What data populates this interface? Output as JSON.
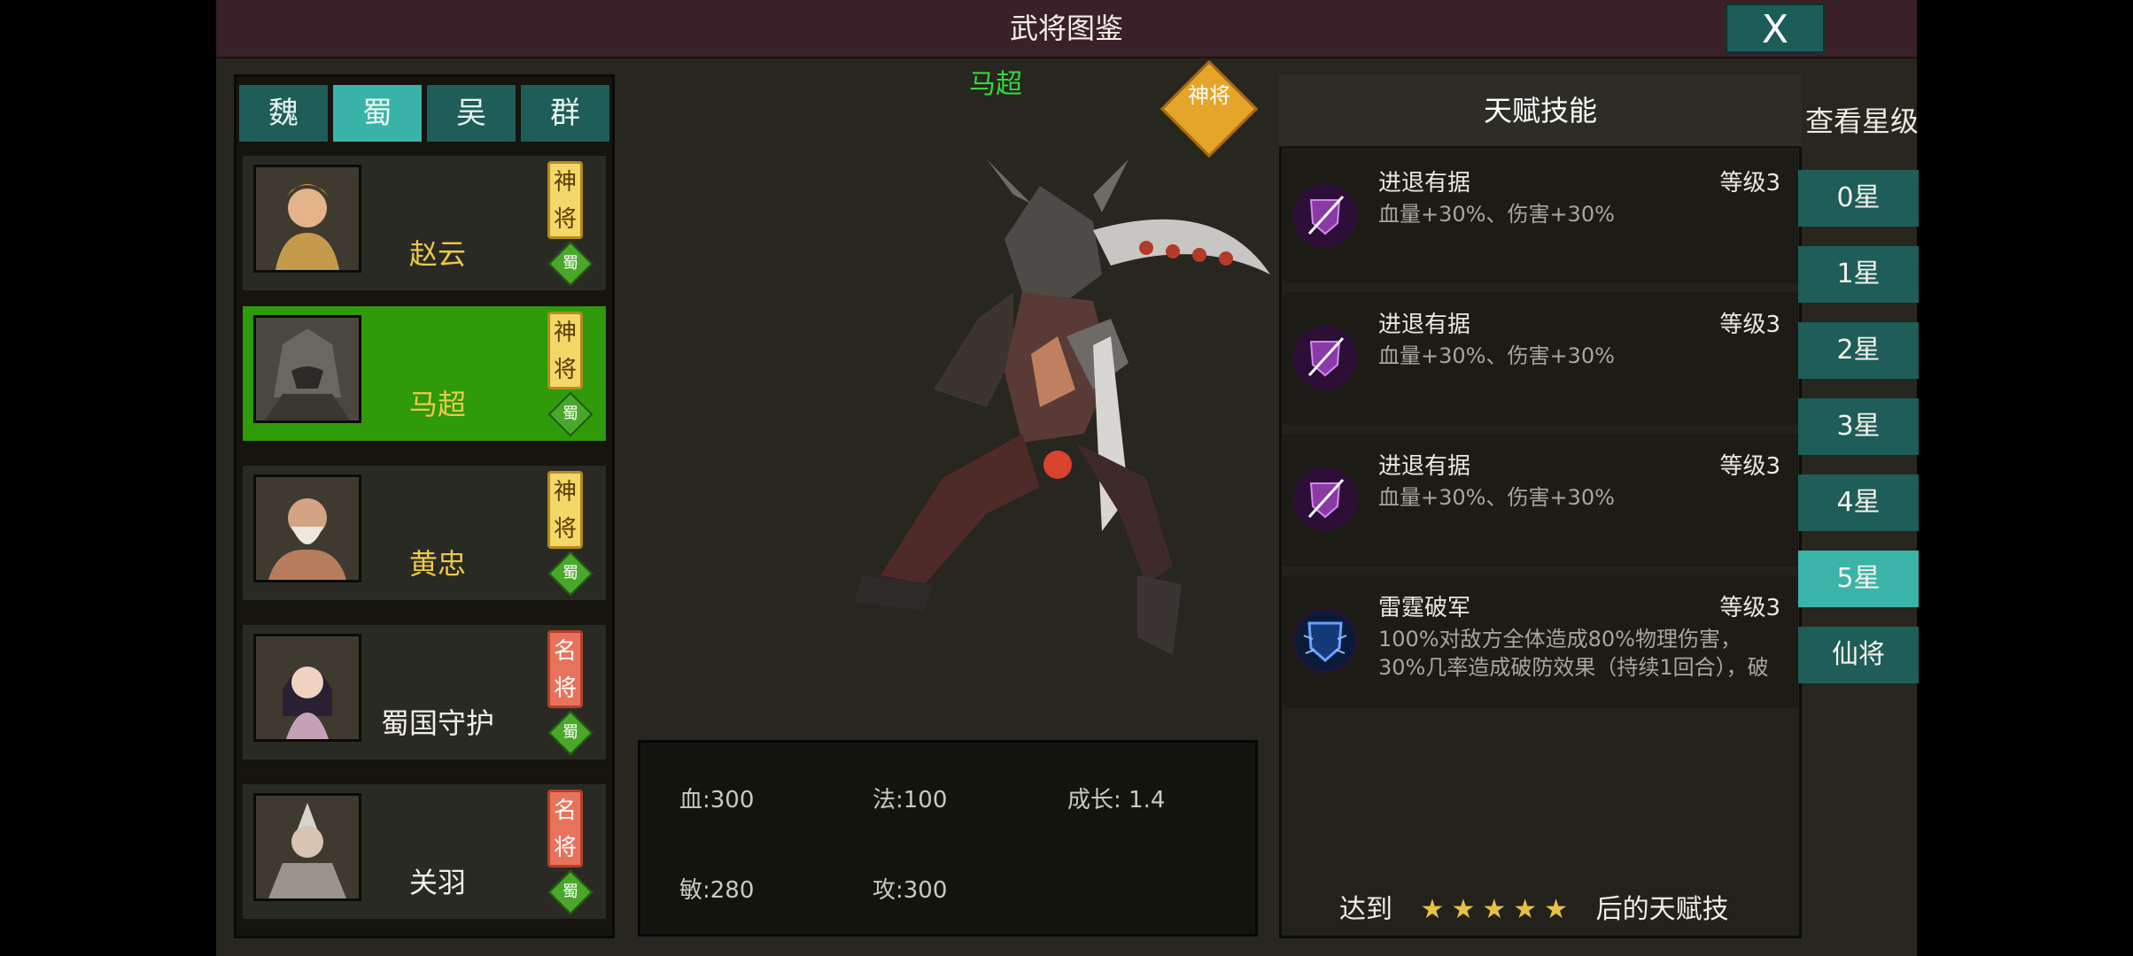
{
  "window": {
    "title": "武将图鉴",
    "close_label": "X"
  },
  "faction_tabs": [
    {
      "label": "魏",
      "active": false
    },
    {
      "label": "蜀",
      "active": true
    },
    {
      "label": "吴",
      "active": false
    },
    {
      "label": "群",
      "active": false
    }
  ],
  "heroes": [
    {
      "name": "赵云",
      "rank": "神将",
      "faction": "蜀",
      "selected": false
    },
    {
      "name": "马超",
      "rank": "神将",
      "faction": "蜀",
      "selected": true
    },
    {
      "name": "黄忠",
      "rank": "神将",
      "faction": "蜀",
      "selected": false
    },
    {
      "name": "蜀国守护",
      "rank": "名将",
      "faction": "蜀",
      "selected": false
    },
    {
      "name": "关羽",
      "rank": "名将",
      "faction": "蜀",
      "selected": false
    }
  ],
  "selected_hero": {
    "name": "马超",
    "rank_badge": "神将"
  },
  "stats": {
    "hp": "血:300",
    "mp": "法:100",
    "growth": "成长: 1.4",
    "agility": "敏:280",
    "attack": "攻:300"
  },
  "talent_panel": {
    "title": "天赋技能",
    "skills": [
      {
        "name": "进退有据",
        "level": "等级3",
        "desc": "血量+30%、伤害+30%",
        "icon": "purple-shield-sword-icon"
      },
      {
        "name": "进退有据",
        "level": "等级3",
        "desc": "血量+30%、伤害+30%",
        "icon": "purple-shield-sword-icon"
      },
      {
        "name": "进退有据",
        "level": "等级3",
        "desc": "血量+30%、伤害+30%",
        "icon": "purple-shield-sword-icon"
      },
      {
        "name": "雷霆破军",
        "level": "等级3",
        "desc": "100%对敌方全体造成80%物理伤害，30%几率造成破防效果（持续1回合），破",
        "icon": "blue-lightning-shield-icon"
      }
    ],
    "footer_prefix": "达到",
    "footer_stars": 5,
    "footer_suffix": "后的天赋技"
  },
  "star_selector": {
    "title": "查看星级",
    "options": [
      {
        "label": "0星",
        "active": false
      },
      {
        "label": "1星",
        "active": false
      },
      {
        "label": "2星",
        "active": false
      },
      {
        "label": "3星",
        "active": false
      },
      {
        "label": "4星",
        "active": false
      },
      {
        "label": "5星",
        "active": true
      },
      {
        "label": "仙将",
        "active": false
      }
    ]
  },
  "colors": {
    "accent": "#39b3a7",
    "tab": "#1e5d58",
    "selected_row": "#2f9a0a",
    "hero_name": "#ebc94a"
  }
}
